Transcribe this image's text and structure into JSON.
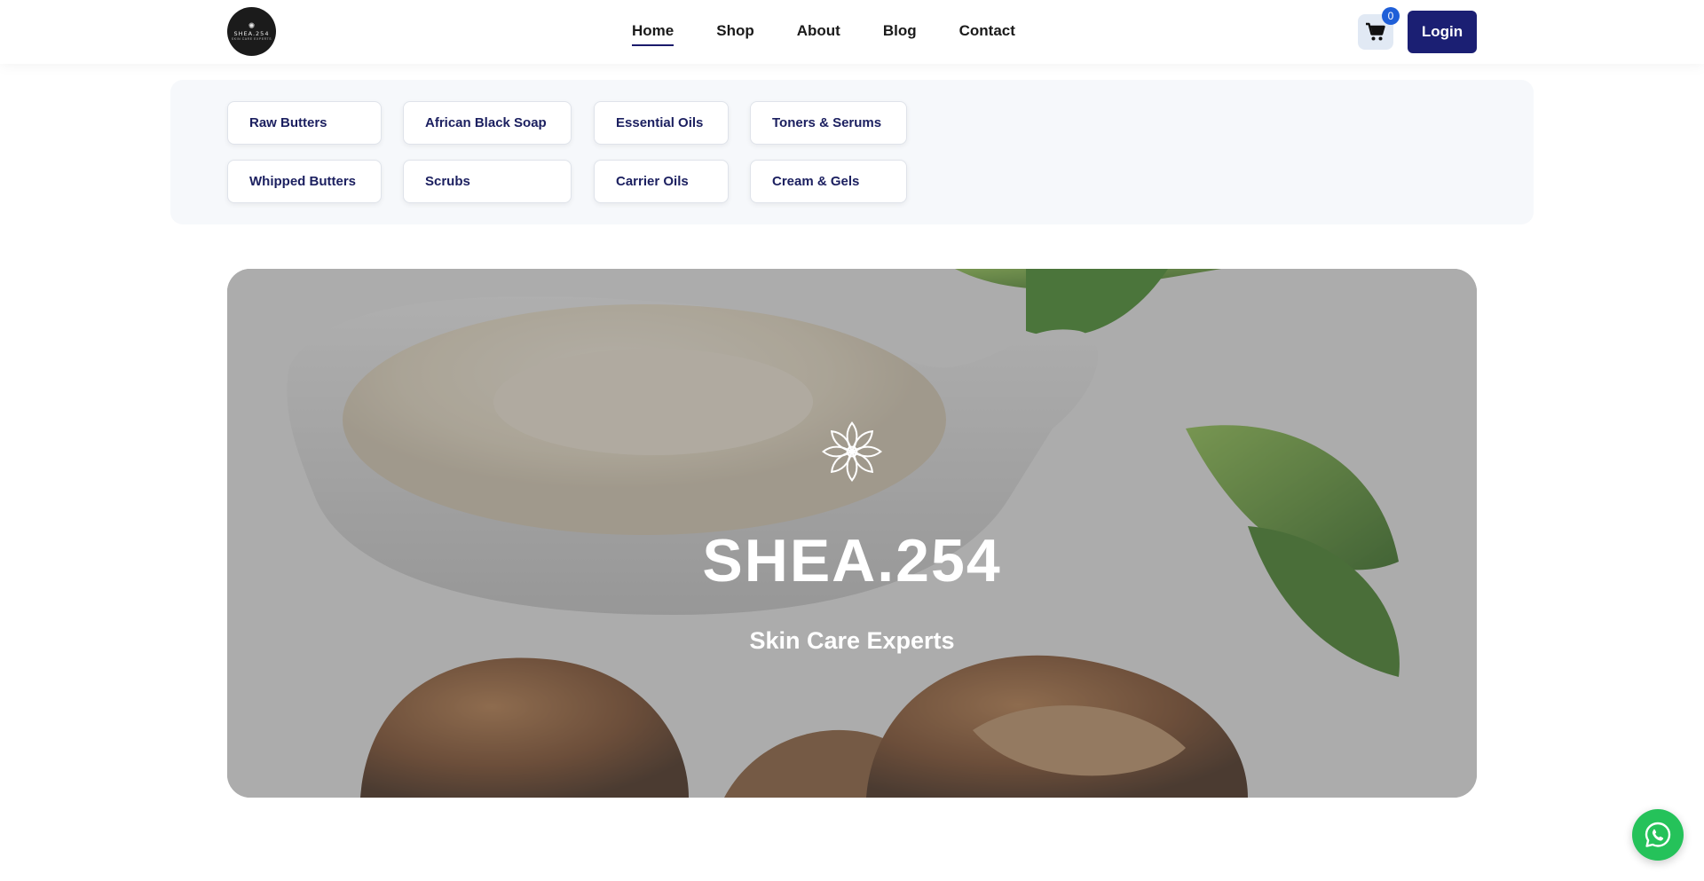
{
  "brand": {
    "logo_word": "SHEA.254",
    "logo_sub": "skin care experts"
  },
  "nav": {
    "items": [
      {
        "label": "Home",
        "active": true
      },
      {
        "label": "Shop",
        "active": false
      },
      {
        "label": "About",
        "active": false
      },
      {
        "label": "Blog",
        "active": false
      },
      {
        "label": "Contact",
        "active": false
      }
    ]
  },
  "cart": {
    "count": "0",
    "icon": "cart-icon"
  },
  "login": {
    "label": "Login"
  },
  "categories": [
    {
      "label": "Raw Butters"
    },
    {
      "label": "African Black Soap"
    },
    {
      "label": "Essential Oils"
    },
    {
      "label": "Toners & Serums"
    },
    {
      "label": "Whipped Butters"
    },
    {
      "label": "Scrubs"
    },
    {
      "label": "Carrier Oils"
    },
    {
      "label": "Cream & Gels"
    }
  ],
  "hero": {
    "icon": "lotus-icon",
    "title": "SHEA.254",
    "subtitle": "Skin Care Experts"
  },
  "whatsapp": {
    "icon": "whatsapp-icon"
  },
  "colors": {
    "accent": "#1b1f73",
    "badge": "#1f5fd8",
    "whatsapp": "#25c25a"
  }
}
